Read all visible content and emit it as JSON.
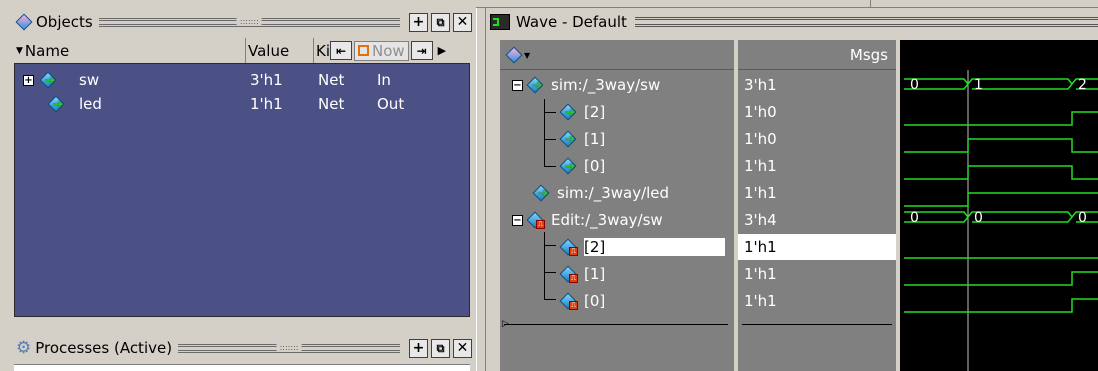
{
  "objects_pane": {
    "title": "Objects",
    "columns": {
      "name": "Name",
      "value": "Value",
      "kind": "Ki",
      "now": "Now"
    },
    "rows": [
      {
        "name": "sw",
        "value": "3'h1",
        "kind": "Net",
        "mode": "In",
        "expandable": true
      },
      {
        "name": "led",
        "value": "1'h1",
        "kind": "Net",
        "mode": "Out",
        "expandable": false
      }
    ]
  },
  "processes_pane": {
    "title": "Processes (Active)"
  },
  "wave_pane": {
    "title": "Wave - Default",
    "msgs_header": "Msgs",
    "rows": [
      {
        "name": "sim:/_3way/sw",
        "value": "3'h1",
        "type": "sim",
        "level": 0,
        "expanded": true
      },
      {
        "name": "[2]",
        "value": "1'h0",
        "type": "sim",
        "level": 1
      },
      {
        "name": "[1]",
        "value": "1'h0",
        "type": "sim",
        "level": 1
      },
      {
        "name": "[0]",
        "value": "1'h1",
        "type": "sim",
        "level": 1
      },
      {
        "name": "sim:/_3way/led",
        "value": "1'h1",
        "type": "sim",
        "level": 0
      },
      {
        "name": "Edit:/_3way/sw",
        "value": "3'h4",
        "type": "edit",
        "level": 0,
        "expanded": true
      },
      {
        "name": "[2]",
        "value": "1'h1",
        "type": "edit",
        "level": 1,
        "selected": true
      },
      {
        "name": "[1]",
        "value": "1'h1",
        "type": "edit",
        "level": 1
      },
      {
        "name": "[0]",
        "value": "1'h1",
        "type": "edit",
        "level": 1
      }
    ],
    "bus_labels_sim": [
      "0",
      "1",
      "2"
    ],
    "bus_labels_edit": [
      "0",
      "0",
      "0"
    ]
  },
  "colors": {
    "wave_green": "#22dd22",
    "cursor": "#c0c0c0",
    "panel_bg": "#4b5185"
  }
}
